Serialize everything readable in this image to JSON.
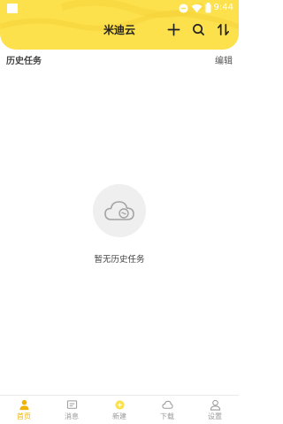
{
  "status_bar": {
    "time": "9:44"
  },
  "header": {
    "title": "米迪云"
  },
  "section": {
    "title": "历史任务",
    "edit_label": "编辑"
  },
  "empty_state": {
    "message": "暂无历史任务"
  },
  "tabs": [
    {
      "label": "首页",
      "icon": "home-icon",
      "active": true
    },
    {
      "label": "消息",
      "icon": "message-icon",
      "active": false
    },
    {
      "label": "新建",
      "icon": "new-icon",
      "active": false
    },
    {
      "label": "下载",
      "icon": "download-cloud-icon",
      "active": false
    },
    {
      "label": "设置",
      "icon": "settings-icon",
      "active": false
    }
  ],
  "colors": {
    "accent": "#fce04c",
    "active_tab": "#f0b400"
  }
}
